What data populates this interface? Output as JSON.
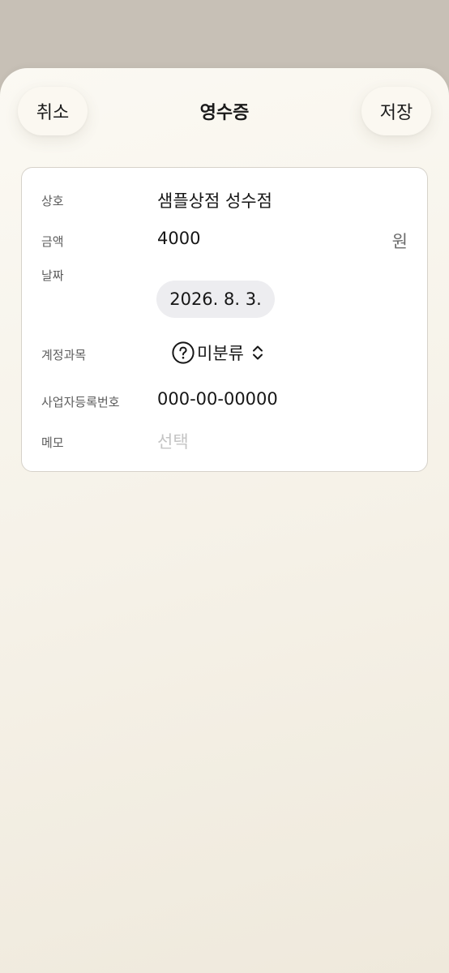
{
  "header": {
    "cancel_label": "취소",
    "title": "영수증",
    "save_label": "저장"
  },
  "form": {
    "store": {
      "label": "상호",
      "value": "샘플상점 성수점"
    },
    "amount": {
      "label": "금액",
      "value": "4000",
      "unit": "원"
    },
    "date": {
      "label": "날짜",
      "value": "2026. 8. 3."
    },
    "category": {
      "label": "계정과목",
      "value": "미분류",
      "icon": "question-circle-icon",
      "chevron": "chevron-up-down-icon"
    },
    "business_number": {
      "label": "사업자등록번호",
      "value": "000-00-00000"
    },
    "memo": {
      "label": "메모",
      "placeholder": "선택"
    }
  }
}
